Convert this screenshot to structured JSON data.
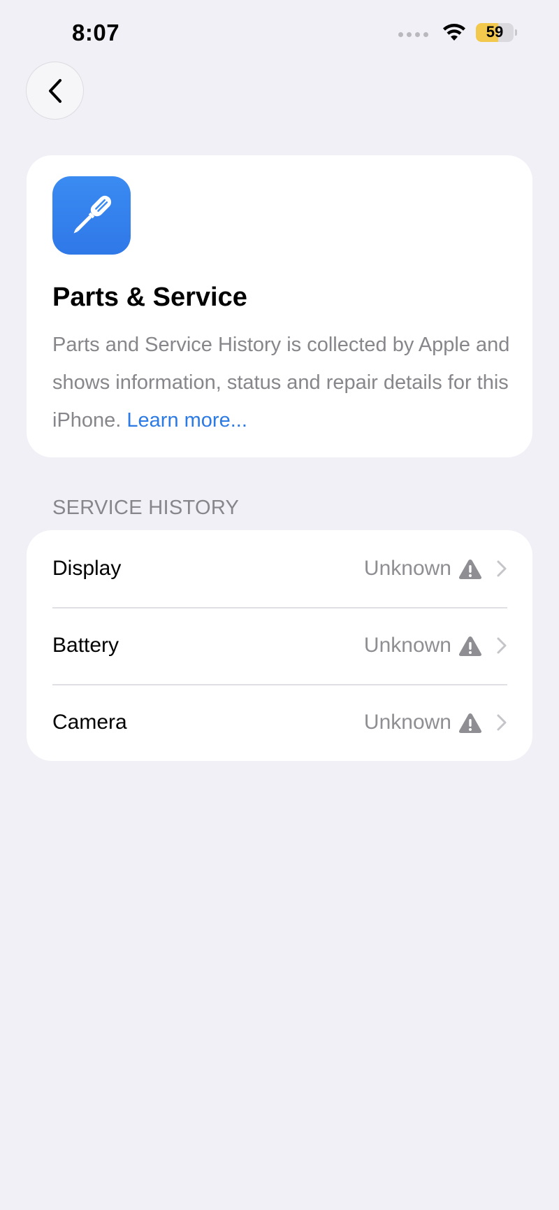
{
  "status_bar": {
    "time": "8:07",
    "battery_level": "59",
    "battery_color": "#f2c94c"
  },
  "navigation": {
    "back_icon": "chevron-left-icon"
  },
  "header": {
    "icon": "screwdriver-icon",
    "icon_color": "#2f78e8",
    "title": "Parts & Service",
    "description": "Parts and Service History is collected by Apple and shows information, status and repair details for this iPhone.",
    "learn_more": "Learn more..."
  },
  "service_history": {
    "section_title": "SERVICE HISTORY",
    "items": [
      {
        "label": "Display",
        "status": "Unknown",
        "status_icon": "warning-icon"
      },
      {
        "label": "Battery",
        "status": "Unknown",
        "status_icon": "warning-icon"
      },
      {
        "label": "Camera",
        "status": "Unknown",
        "status_icon": "warning-icon"
      }
    ]
  },
  "colors": {
    "background": "#f1f0f6",
    "link": "#2c7ae3",
    "secondary_text": "#86868b"
  }
}
